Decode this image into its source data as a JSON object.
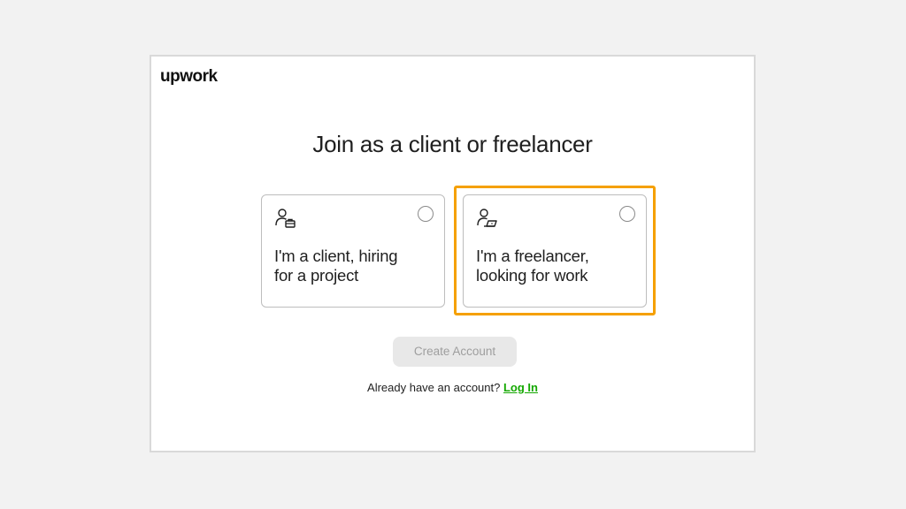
{
  "brand": {
    "logo_text": "upwork"
  },
  "page": {
    "title": "Join as a client or freelancer"
  },
  "options": [
    {
      "id": "client",
      "icon": "client-briefcase-icon",
      "label_line1": "I'm a client, hiring",
      "label_line2": "for a project",
      "selected": false
    },
    {
      "id": "freelancer",
      "icon": "freelancer-laptop-icon",
      "label_line1": "I'm a freelancer,",
      "label_line2": "looking for work",
      "selected": false,
      "highlighted": true
    }
  ],
  "actions": {
    "create_account_label": "Create Account",
    "create_account_disabled": true
  },
  "footer": {
    "prompt": "Already have an account?",
    "login_label": "Log In"
  },
  "colors": {
    "highlight": "#f5a000",
    "link": "#14a800",
    "button_disabled_bg": "#e8e8e8",
    "button_disabled_text": "#9e9e9e"
  }
}
